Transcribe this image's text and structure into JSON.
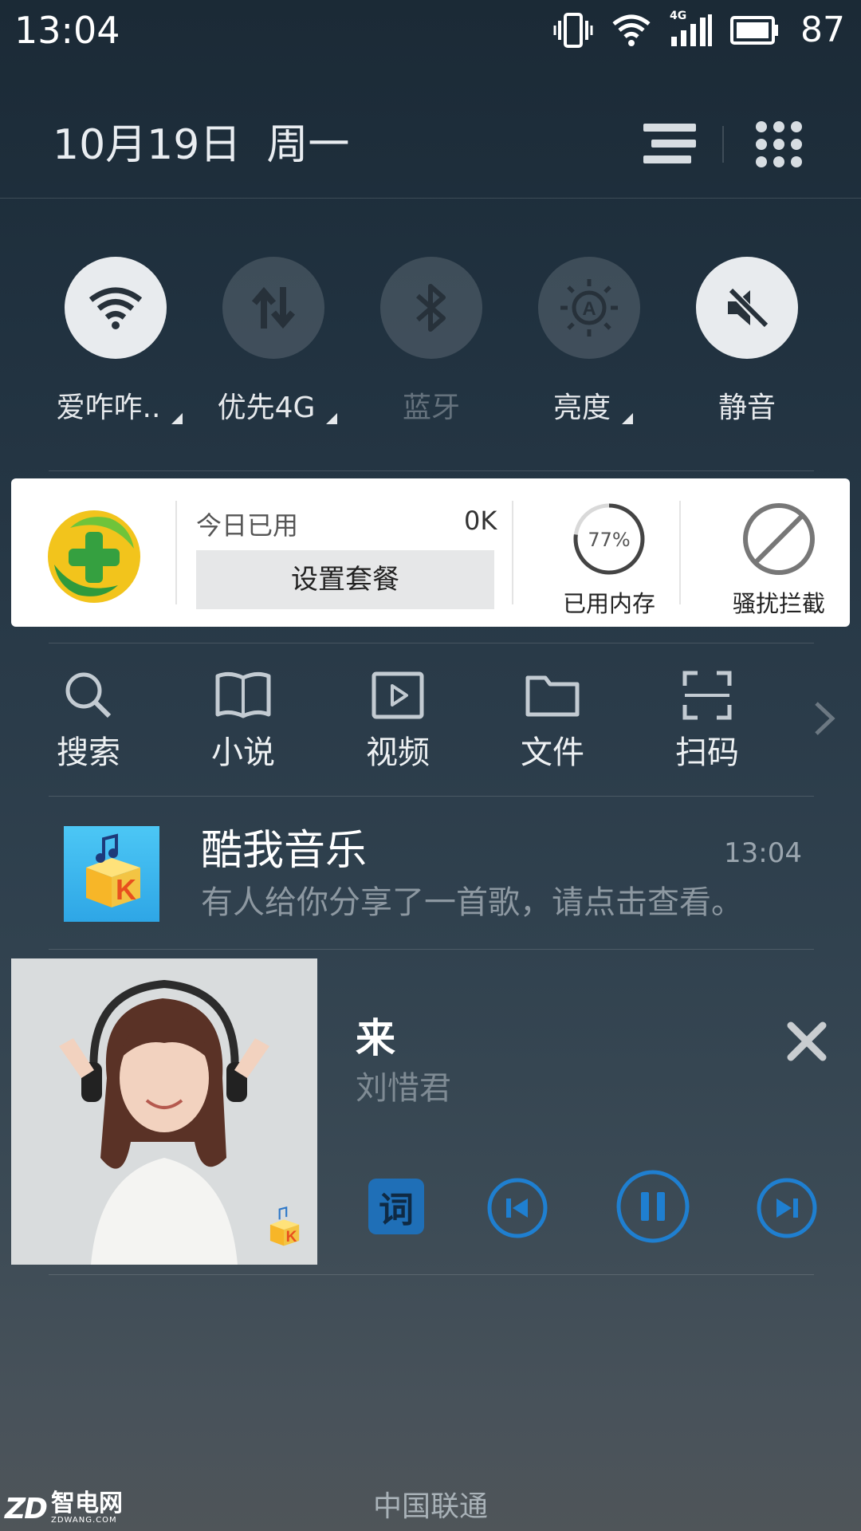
{
  "status_bar": {
    "time": "13:04",
    "network_badge": "4G",
    "battery_percent": "87",
    "icons": [
      "vibrate-icon",
      "wifi-icon",
      "cellular-4g-icon",
      "battery-icon"
    ]
  },
  "header": {
    "date": "10月19日",
    "weekday": "周一",
    "icons": [
      "list-icon",
      "grid-icon"
    ]
  },
  "toggles": [
    {
      "label": "爱咋咋..",
      "icon": "wifi-icon",
      "state": "on",
      "has_menu": true
    },
    {
      "label": "优先4G",
      "icon": "data-arrows-icon",
      "state": "off",
      "has_menu": true
    },
    {
      "label": "蓝牙",
      "icon": "bluetooth-icon",
      "state": "off",
      "has_menu": false
    },
    {
      "label": "亮度",
      "icon": "brightness-auto-icon",
      "state": "off",
      "has_menu": true
    },
    {
      "label": "静音",
      "icon": "mute-icon",
      "state": "on",
      "has_menu": false
    }
  ],
  "security_card": {
    "today_used_label": "今日已用",
    "today_used_value": "0K",
    "set_plan_button": "设置套餐",
    "memory_percent_text": "77%",
    "memory_percent": 77,
    "memory_label": "已用内存",
    "block_label": "骚扰拦截"
  },
  "shortcuts": [
    {
      "label": "搜索",
      "icon": "search-icon"
    },
    {
      "label": "小说",
      "icon": "book-icon"
    },
    {
      "label": "视频",
      "icon": "video-icon"
    },
    {
      "label": "文件",
      "icon": "folder-icon"
    },
    {
      "label": "扫码",
      "icon": "scan-icon"
    }
  ],
  "notification": {
    "app": "酷我音乐",
    "time": "13:04",
    "text": "有人给你分享了一首歌，请点击查看。"
  },
  "player": {
    "title": "来",
    "artist": "刘惜君",
    "lyric_button": "词",
    "controls": [
      "previous-icon",
      "pause-icon",
      "next-icon"
    ],
    "accent": "#1f7fd0"
  },
  "footer": {
    "carrier": "中国联通",
    "watermark_brand": "ZD",
    "watermark_name": "智电网",
    "watermark_url": "ZDWANG.COM"
  }
}
